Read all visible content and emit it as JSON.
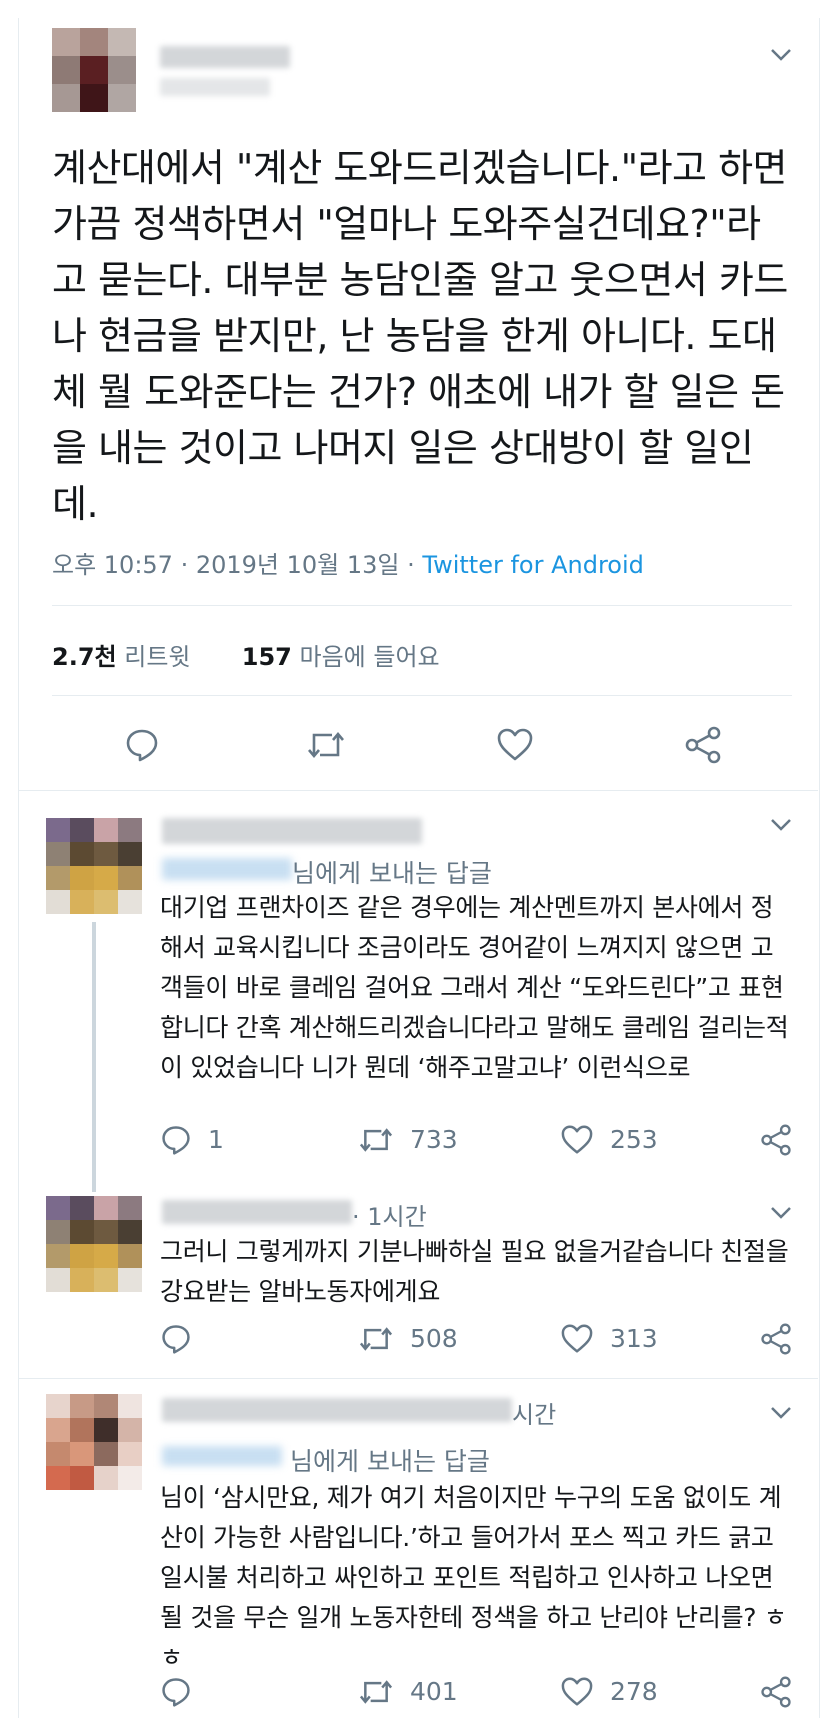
{
  "main_tweet": {
    "text": "계산대에서 \"계산 도와드리겠습니다.\"라고 하면 가끔 정색하면서  \"얼마나 도와주실건데요?\"라고 묻는다. 대부분 농담인줄 알고 웃으면서 카드나 현금을 받지만, 난 농담을 한게 아니다. 도대체 뭘 도와준다는 건가? 애초에 내가 할 일은 돈을 내는 것이고 나머지 일은 상대방이 할 일인데.",
    "timestamp": "오후 10:57 · 2019년 10월 13일 · ",
    "source": "Twitter for Android",
    "retweets_count": "2.7천",
    "retweets_label": " 리트윗",
    "likes_count": "157",
    "likes_label": " 마음에 들어요"
  },
  "replies": [
    {
      "replying_to": "님에게 보내는 답글",
      "text": "대기업 프랜차이즈 같은 경우에는 계산멘트까지 본사에서 정해서 교육시킵니다 조금이라도 경어같이 느껴지지 않으면 고객들이 바로 클레임 걸어요 그래서 계산 “도와드린다”고 표현합니다 간혹 계산해드리겠습니다라고 말해도 클레임 걸리는적이 있었습니다 니가 뭔데 ‘해주고말고냐’ 이런식으로",
      "reply_count": "1",
      "retweet_count": "733",
      "like_count": "253"
    },
    {
      "time": "· 1시간",
      "text": "그러니 그렇게까지 기분나빠하실 필요 없을거같습니다 친절을 강요받는 알바노동자에게요",
      "reply_count": "",
      "retweet_count": "508",
      "like_count": "313"
    },
    {
      "time": "시간",
      "replying_to": "님에게 보내는 답글",
      "text": "님이 ‘삼시만요, 제가 여기 처음이지만 누구의 도움 없이도 계산이 가능한 사람입니다.’하고 들어가서 포스 찍고 카드 긁고 일시불 처리하고 싸인하고 포인트 적립하고 인사하고 나오면 될 것을 무슨 일개 노동자한테 정색을 하고 난리야 난리를? ㅎㅎ",
      "reply_count": "",
      "retweet_count": "401",
      "like_count": "278"
    }
  ],
  "icons": {
    "reply": "comment-bubble-icon",
    "retweet": "retweet-icon",
    "like": "heart-icon",
    "share": "share-icon",
    "more": "chevron-down-icon"
  },
  "colors": {
    "text": "#14171a",
    "secondary": "#657786",
    "link": "#1b95e0",
    "divider": "#e6ecf0"
  }
}
